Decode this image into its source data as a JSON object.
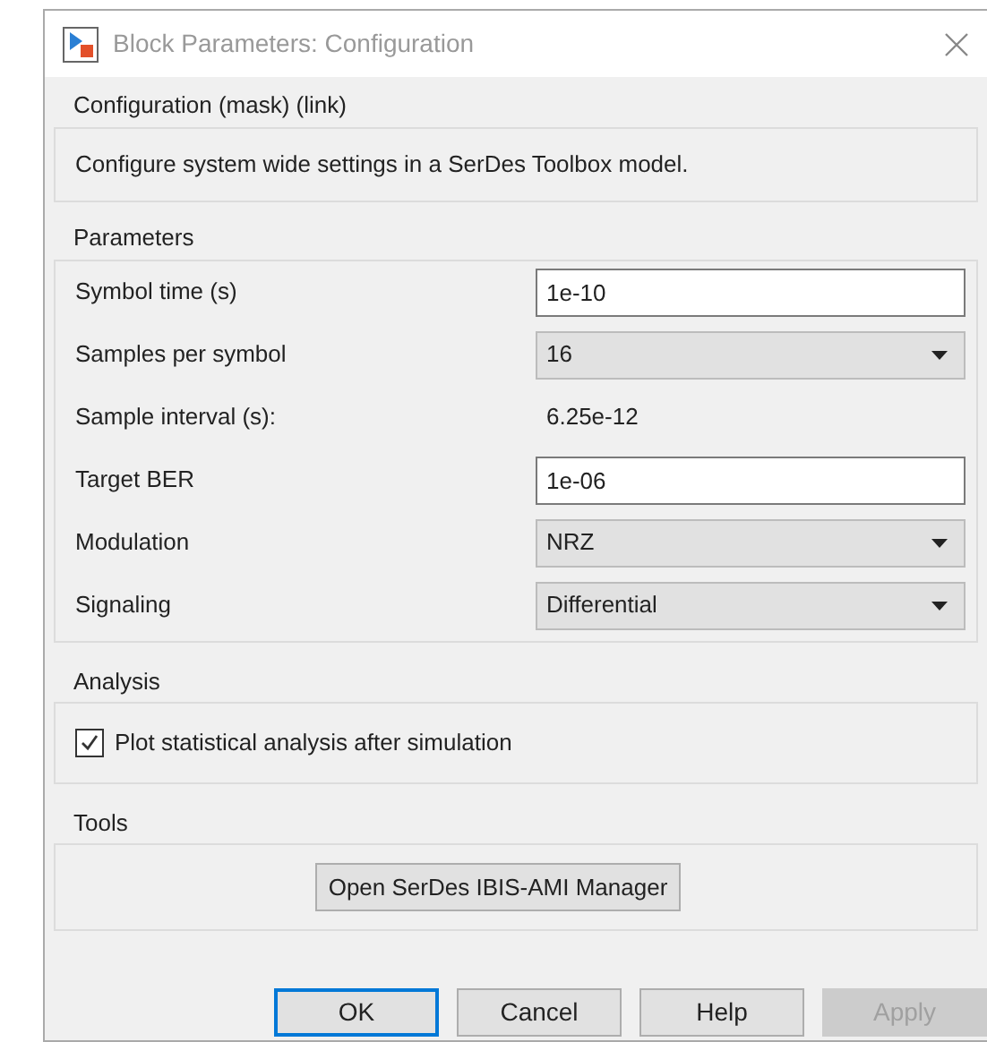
{
  "window": {
    "title": "Block Parameters: Configuration"
  },
  "mask": {
    "title": "Configuration (mask) (link)",
    "description": "Configure system wide settings in a SerDes Toolbox model."
  },
  "parameters": {
    "title": "Parameters",
    "rows": [
      {
        "kind": "edit",
        "label": "Symbol time (s)",
        "value": "1e-10"
      },
      {
        "kind": "dropdown",
        "label": "Samples per symbol",
        "value": "16"
      },
      {
        "kind": "readout",
        "label": "Sample interval (s):",
        "value": "6.25e-12"
      },
      {
        "kind": "edit",
        "label": "Target BER",
        "value": "1e-06"
      },
      {
        "kind": "dropdown",
        "label": "Modulation",
        "value": "NRZ"
      },
      {
        "kind": "dropdown",
        "label": "Signaling",
        "value": "Differential"
      }
    ]
  },
  "analysis": {
    "title": "Analysis",
    "checkbox": {
      "label": "Plot statistical analysis after simulation",
      "checked": true
    }
  },
  "tools": {
    "title": "Tools",
    "button": "Open SerDes IBIS-AMI Manager"
  },
  "buttons": [
    {
      "label": "OK",
      "default": true,
      "disabled": false
    },
    {
      "label": "Cancel",
      "default": false,
      "disabled": false
    },
    {
      "label": "Help",
      "default": false,
      "disabled": false
    },
    {
      "label": "Apply",
      "default": false,
      "disabled": true
    }
  ]
}
